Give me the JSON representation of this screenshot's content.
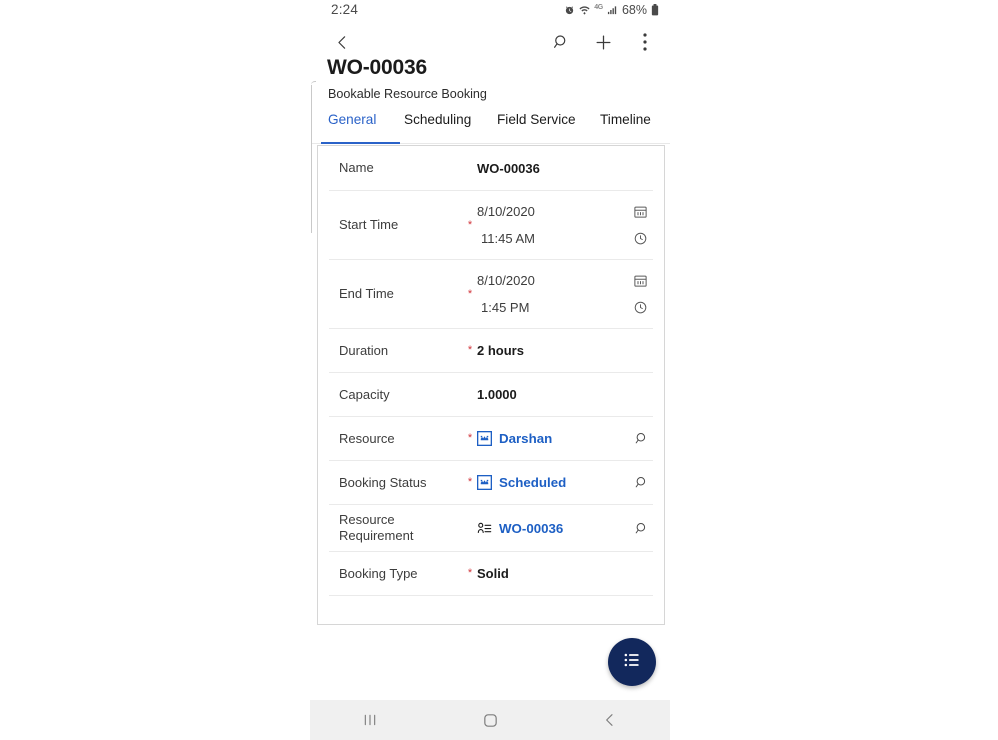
{
  "status_bar": {
    "time": "2:24",
    "battery_percent": "68%",
    "network_label": "4G",
    "icons": [
      "alarm-icon",
      "wifi-icon",
      "network-4g-icon",
      "signal-bars-icon",
      "battery-icon"
    ]
  },
  "app_bar": {
    "back_label": "Back",
    "search_label": "Search",
    "add_label": "New",
    "more_label": "More commands"
  },
  "header": {
    "record_title": "WO-00036",
    "entity_name": "Bookable Resource Booking"
  },
  "tabs": [
    {
      "label": "General",
      "active": true
    },
    {
      "label": "Scheduling",
      "active": false
    },
    {
      "label": "Field Service",
      "active": false
    },
    {
      "label": "Timeline",
      "active": false
    }
  ],
  "form": {
    "fields": [
      {
        "label": "Name",
        "required": false,
        "type": "text",
        "value": "WO-00036"
      },
      {
        "label": "Start Time",
        "required": true,
        "type": "datetime",
        "date": "8/10/2020",
        "time": "11:45 AM"
      },
      {
        "label": "End Time",
        "required": true,
        "type": "datetime",
        "date": "8/10/2020",
        "time": "1:45 PM"
      },
      {
        "label": "Duration",
        "required": true,
        "type": "text",
        "value": "2 hours"
      },
      {
        "label": "Capacity",
        "required": false,
        "type": "text",
        "value": "1.0000"
      },
      {
        "label": "Resource",
        "required": true,
        "type": "lookup",
        "value": "Darshan",
        "icon": "bookable-resource-icon"
      },
      {
        "label": "Booking Status",
        "required": true,
        "type": "lookup",
        "value": "Scheduled",
        "icon": "booking-status-icon"
      },
      {
        "label": "Resource Requirement",
        "required": false,
        "type": "lookup",
        "value": "WO-00036",
        "icon": "resource-requirement-icon"
      },
      {
        "label": "Booking Type",
        "required": true,
        "type": "text",
        "value": "Solid"
      }
    ]
  },
  "fab": {
    "label": "Related records",
    "icon": "list-menu-icon",
    "color": "#12285c"
  },
  "nav_bar": {
    "recents_label": "Recents",
    "home_label": "Home",
    "back_label": "Back"
  },
  "colors": {
    "accent": "#2a62c8",
    "link": "#1d5fc4",
    "required": "#d1343a",
    "fab": "#12285c"
  }
}
